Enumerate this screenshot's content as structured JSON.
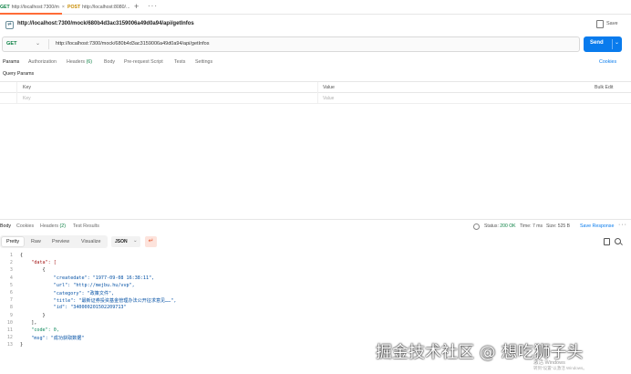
{
  "tabs": [
    {
      "method": "GET",
      "label": "http://localhost:7300/m",
      "close": "×"
    },
    {
      "method": "POST",
      "label": "http://localhost:8080/..."
    }
  ],
  "tabstrip": {
    "new_tab": "+",
    "more": "···"
  },
  "request": {
    "title": "http://localhost:7300/mock/680b4d3ac3159006a49d0a94/api/getInfos",
    "save_label": "Save",
    "method": "GET",
    "url": "http://localhost:7300/mock/680b4d3ac3159006a49d0a94/api/getInfos",
    "send_label": "Send"
  },
  "request_tabs": {
    "params": "Params",
    "authorization": "Authorization",
    "headers": "Headers",
    "headers_count": "(6)",
    "body": "Body",
    "prerequest": "Pre-request Script",
    "tests": "Tests",
    "settings": "Settings",
    "cookies": "Cookies"
  },
  "query_params": {
    "section_label": "Query Params",
    "col_key": "Key",
    "col_value": "Value",
    "bulk_edit": "Bulk Edit",
    "key_placeholder": "Key",
    "value_placeholder": "Value"
  },
  "response_tabs": {
    "body": "Body",
    "cookies": "Cookies",
    "headers": "Headers",
    "headers_count": "(2)",
    "test_results": "Test Results"
  },
  "response_status": {
    "status_label": "Status:",
    "status_value": "200 OK",
    "time": "Time: 7 ms",
    "size": "Size: 525 B",
    "save_response": "Save Response",
    "more": "···"
  },
  "response_toolbar": {
    "pretty": "Pretty",
    "raw": "Raw",
    "preview": "Preview",
    "visualize": "Visualize",
    "format": "JSON"
  },
  "code": [
    {
      "ln": "1",
      "text": "{"
    },
    {
      "ln": "2",
      "text": "    \"data\": ["
    },
    {
      "ln": "3",
      "text": "        {"
    },
    {
      "ln": "4",
      "text": "            \"createdate\": \"1977-09-08 16:38:11\","
    },
    {
      "ln": "5",
      "text": "            \"url\": \"http://mejbu.hu/vvp\","
    },
    {
      "ln": "6",
      "text": "            \"category\": \"政策文件\","
    },
    {
      "ln": "7",
      "text": "            \"title\": \"最新证券投资基金管理办法公开征求意见……\","
    },
    {
      "ln": "8",
      "text": "            \"id\": \"340000201502209713\""
    },
    {
      "ln": "9",
      "text": "        }"
    },
    {
      "ln": "10",
      "text": "    ],"
    },
    {
      "ln": "11",
      "text": "    \"code\": 0,"
    },
    {
      "ln": "12",
      "text": "    \"msg\": \"成功获取数据\""
    },
    {
      "ln": "13",
      "text": "}"
    }
  ],
  "watermark": {
    "text": "掘金技术社区 @ 想吃狮子头",
    "activate": "激活 Windows",
    "activate_hint": "转到\"设置\"以激活 Windows。"
  },
  "colors": {
    "accent": "#ff6c37",
    "send": "#097bed",
    "get": "#0b8043",
    "post": "#c88b00"
  }
}
